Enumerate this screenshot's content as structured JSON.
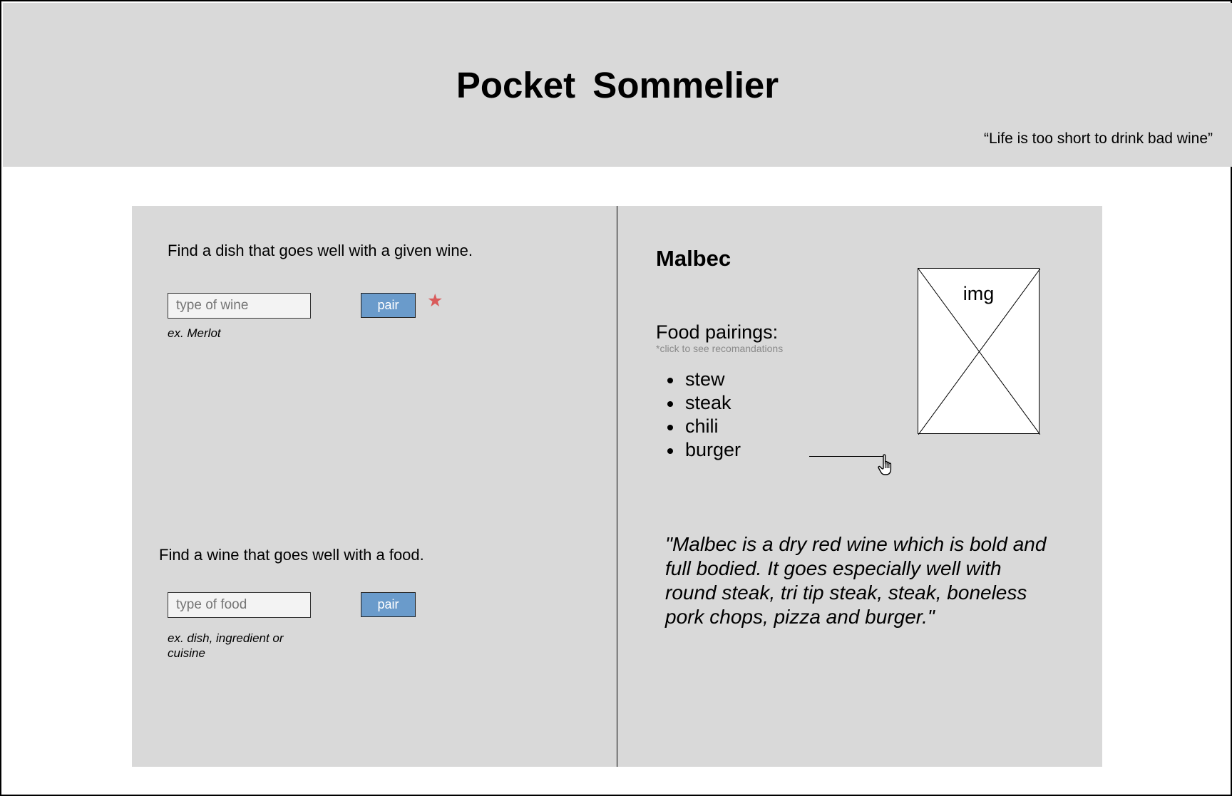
{
  "app": {
    "title": "Pocket Sommelier",
    "tagline": "“Life is too short to drink bad wine”"
  },
  "dish_finder": {
    "prompt": "Find a dish that goes well with a given wine.",
    "input_placeholder": "type of wine",
    "button_label": "pair",
    "hint": "ex. Merlot",
    "star_icon": "star-icon",
    "star_color": "#d95b5b"
  },
  "wine_finder": {
    "prompt": "Find a wine that goes well with a food.",
    "input_placeholder": "type of food",
    "button_label": "pair",
    "hint_line1": "ex. dish, ingredient or",
    "hint_line2": "cuisine"
  },
  "result": {
    "wine_name": "Malbec",
    "pairings_title": "Food pairings:",
    "pairings_note": "*click to see recomandations",
    "foods": [
      "stew",
      "steak",
      "chili",
      "burger"
    ],
    "image_label": "img",
    "description": "\"Malbec is a dry red wine which is bold and full bodied. It goes especially well with round steak, tri tip steak, steak, boneless pork chops, pizza and burger.\""
  },
  "colors": {
    "header_bg": "#d9d9d9",
    "panel_bg": "#d9d9d9",
    "button_bg": "#6a9bcb"
  },
  "icons": {
    "cursor": "hand-pointer-icon",
    "placeholder_image": "image-placeholder-icon"
  }
}
